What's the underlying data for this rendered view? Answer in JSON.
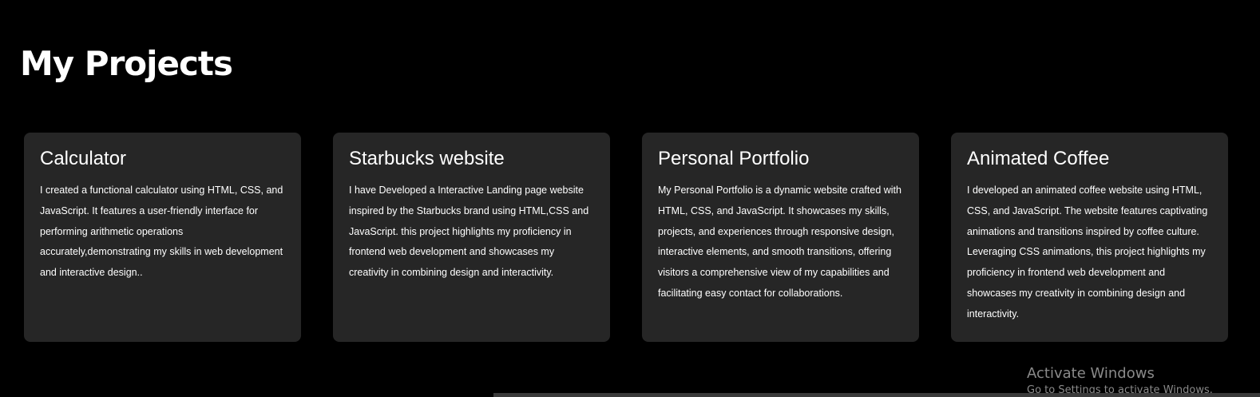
{
  "section": {
    "title": "My Projects"
  },
  "projects": [
    {
      "title": "Calculator",
      "description": "I created a functional calculator using HTML, CSS, and JavaScript. It features a user-friendly interface for performing arithmetic operations accurately,demonstrating my skills in web development and interactive design.."
    },
    {
      "title": "Starbucks website",
      "description": "I have Developed a Interactive Landing page website inspired by the Starbucks brand using HTML,CSS and JavaScript. this project highlights my proficiency in frontend web development and showcases my creativity in combining design and interactivity."
    },
    {
      "title": "Personal Portfolio",
      "description": "My Personal Portfolio is a dynamic website crafted with HTML, CSS, and JavaScript. It showcases my skills, projects, and experiences through responsive design, interactive elements, and smooth transitions, offering visitors a comprehensive view of my capabilities and facilitating easy contact for collaborations."
    },
    {
      "title": "Animated Coffee",
      "description": "I developed an animated coffee website using HTML, CSS, and JavaScript. The website features captivating animations and transitions inspired by coffee culture. Leveraging CSS animations, this project highlights my proficiency in frontend web development and showcases my creativity in combining design and interactivity."
    }
  ],
  "watermark": {
    "title": "Activate Windows",
    "subtitle": "Go to Settings to activate Windows."
  },
  "colors": {
    "background": "#000000",
    "card": "#262626",
    "text": "#ffffff",
    "watermark": "#8a8a8a"
  }
}
